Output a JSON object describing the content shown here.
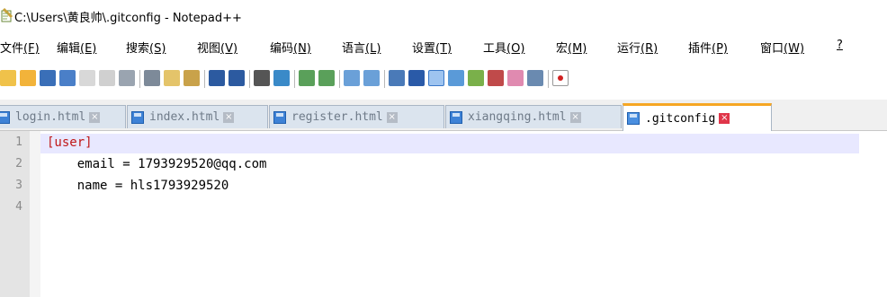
{
  "window": {
    "title": "C:\\Users\\黄良帅\\.gitconfig - Notepad++"
  },
  "menu": [
    {
      "label": "文件",
      "mnemonic": "(F)"
    },
    {
      "label": "编辑",
      "mnemonic": "(E)"
    },
    {
      "label": "搜索",
      "mnemonic": "(S)"
    },
    {
      "label": "视图",
      "mnemonic": "(V)"
    },
    {
      "label": "编码",
      "mnemonic": "(N)"
    },
    {
      "label": "语言",
      "mnemonic": "(L)"
    },
    {
      "label": "设置",
      "mnemonic": "(T)"
    },
    {
      "label": "工具",
      "mnemonic": "(O)"
    },
    {
      "label": "宏",
      "mnemonic": "(M)"
    },
    {
      "label": "运行",
      "mnemonic": "(R)"
    },
    {
      "label": "插件",
      "mnemonic": "(P)"
    },
    {
      "label": "窗口",
      "mnemonic": "(W)"
    },
    {
      "label": "",
      "mnemonic": "?"
    }
  ],
  "toolbar": {
    "icons": [
      "new-file-icon",
      "open-file-icon",
      "save-icon",
      "save-all-icon",
      "close-icon",
      "close-all-icon",
      "print-icon",
      "cut-icon",
      "copy-icon",
      "paste-icon",
      "undo-icon",
      "redo-icon",
      "find-icon",
      "replace-icon",
      "zoom-in-icon",
      "zoom-out-icon",
      "sync-vertical-icon",
      "sync-horizontal-icon",
      "word-wrap-icon",
      "show-all-chars-icon",
      "indent-guide-icon",
      "doc-map-icon",
      "function-list-icon",
      "folder-workspace-icon",
      "monitoring-icon",
      "record-macro-icon"
    ]
  },
  "tabs": [
    {
      "label": "login.html",
      "active": false
    },
    {
      "label": "index.html",
      "active": false
    },
    {
      "label": "register.html",
      "active": false
    },
    {
      "label": "xiangqing.html",
      "active": false
    },
    {
      "label": ".gitconfig",
      "active": true
    }
  ],
  "editor": {
    "line_numbers": [
      "1",
      "2",
      "3",
      "4"
    ],
    "lines": [
      "[user]",
      "    email = 1793929520@qq.com",
      "    name = hls1793929520",
      ""
    ]
  },
  "colors": {
    "section_header": "#c01818",
    "active_tab_accent": "#f6a623",
    "current_line": "#e8e8ff",
    "tab_close_active": "#e0364a"
  }
}
